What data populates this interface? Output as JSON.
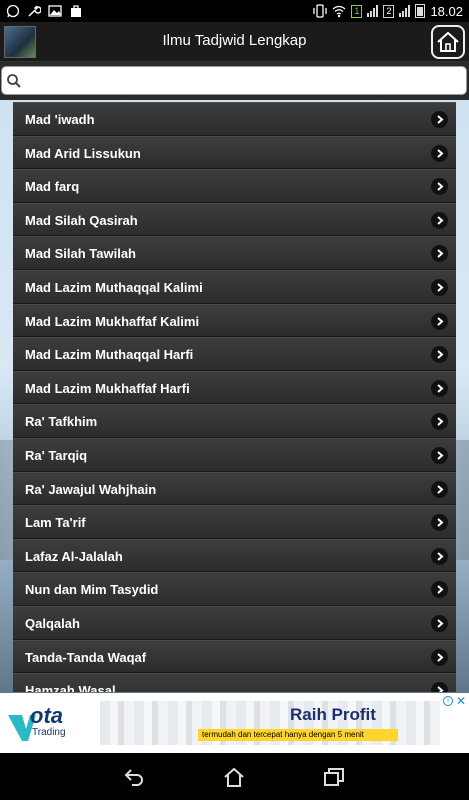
{
  "status_bar": {
    "time": "18.02",
    "sim1": "1",
    "sim2": "2"
  },
  "header": {
    "title": "Ilmu Tadjwid Lengkap"
  },
  "search": {
    "placeholder": ""
  },
  "list": {
    "items": [
      {
        "label": "Mad 'iwadh"
      },
      {
        "label": "Mad Arid Lissukun"
      },
      {
        "label": "Mad farq"
      },
      {
        "label": "Mad Silah Qasirah"
      },
      {
        "label": "Mad Silah Tawilah"
      },
      {
        "label": "Mad Lazim Muthaqqal Kalimi"
      },
      {
        "label": "Mad Lazim Mukhaffaf Kalimi"
      },
      {
        "label": "Mad Lazim Muthaqqal Harfi"
      },
      {
        "label": "Mad Lazim Mukhaffaf Harfi"
      },
      {
        "label": "Ra' Tafkhim"
      },
      {
        "label": "Ra' Tarqiq"
      },
      {
        "label": "Ra' Jawajul Wahjhain"
      },
      {
        "label": "Lam Ta'rif"
      },
      {
        "label": "Lafaz Al-Jalalah"
      },
      {
        "label": "Nun dan Mim Tasydid"
      },
      {
        "label": "Qalqalah"
      },
      {
        "label": "Tanda-Tanda Waqaf"
      },
      {
        "label": "Hamzah Wasal"
      }
    ]
  },
  "ad": {
    "brand": "ota",
    "brand_sub": "Trading",
    "headline": "Raih Profit",
    "strip_text": "termudah dan tercepat hanya dengan 5 menit"
  },
  "colors": {
    "list_item_bg": "#333333",
    "header_bg": "#1b1b1b",
    "ad_accent": "#ffd52a"
  }
}
